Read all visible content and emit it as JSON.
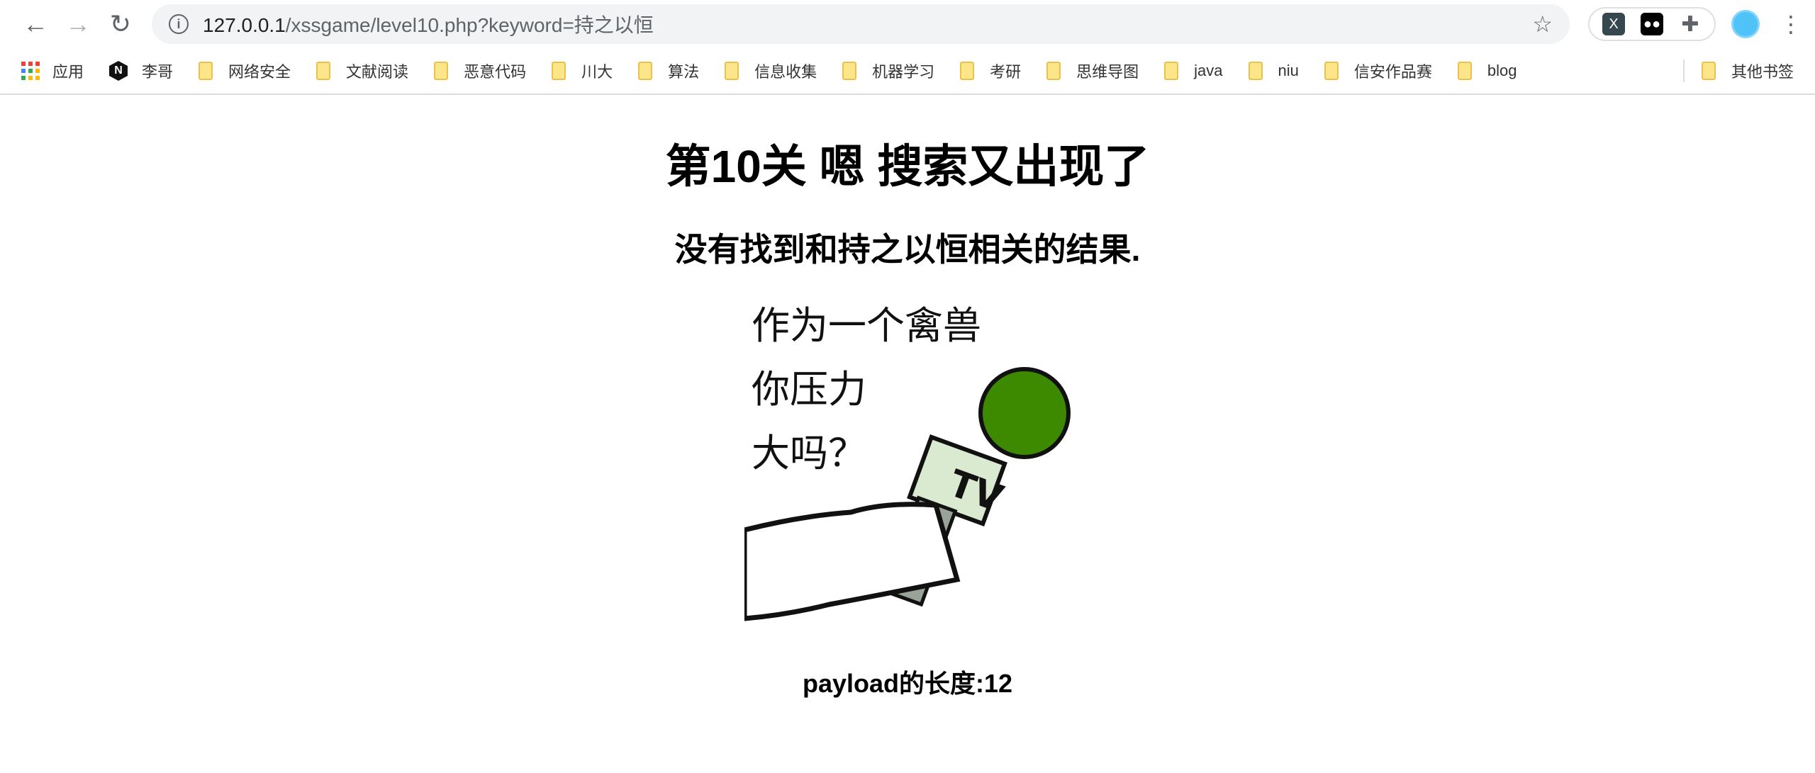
{
  "browser": {
    "url_host": "127.0.0.1",
    "url_path": "/xssgame/level10.php?keyword=持之以恒",
    "ext_x_label": "X"
  },
  "bookmarks": {
    "items": [
      "应用",
      "李哥",
      "网络安全",
      "文献阅读",
      "恶意代码",
      "川大",
      "算法",
      "信息收集",
      "机器学习",
      "考研",
      "思维导图",
      "java",
      "niu",
      "信安作品赛",
      "blog"
    ],
    "other": "其他书签"
  },
  "page": {
    "title": "第10关 嗯 搜索又出现了",
    "result": "没有找到和持之以恒相关的结果.",
    "image_text": [
      "作为一个禽兽",
      "你压力",
      "大吗？"
    ],
    "mic_label": "TV",
    "payload": "payload的长度:12"
  }
}
